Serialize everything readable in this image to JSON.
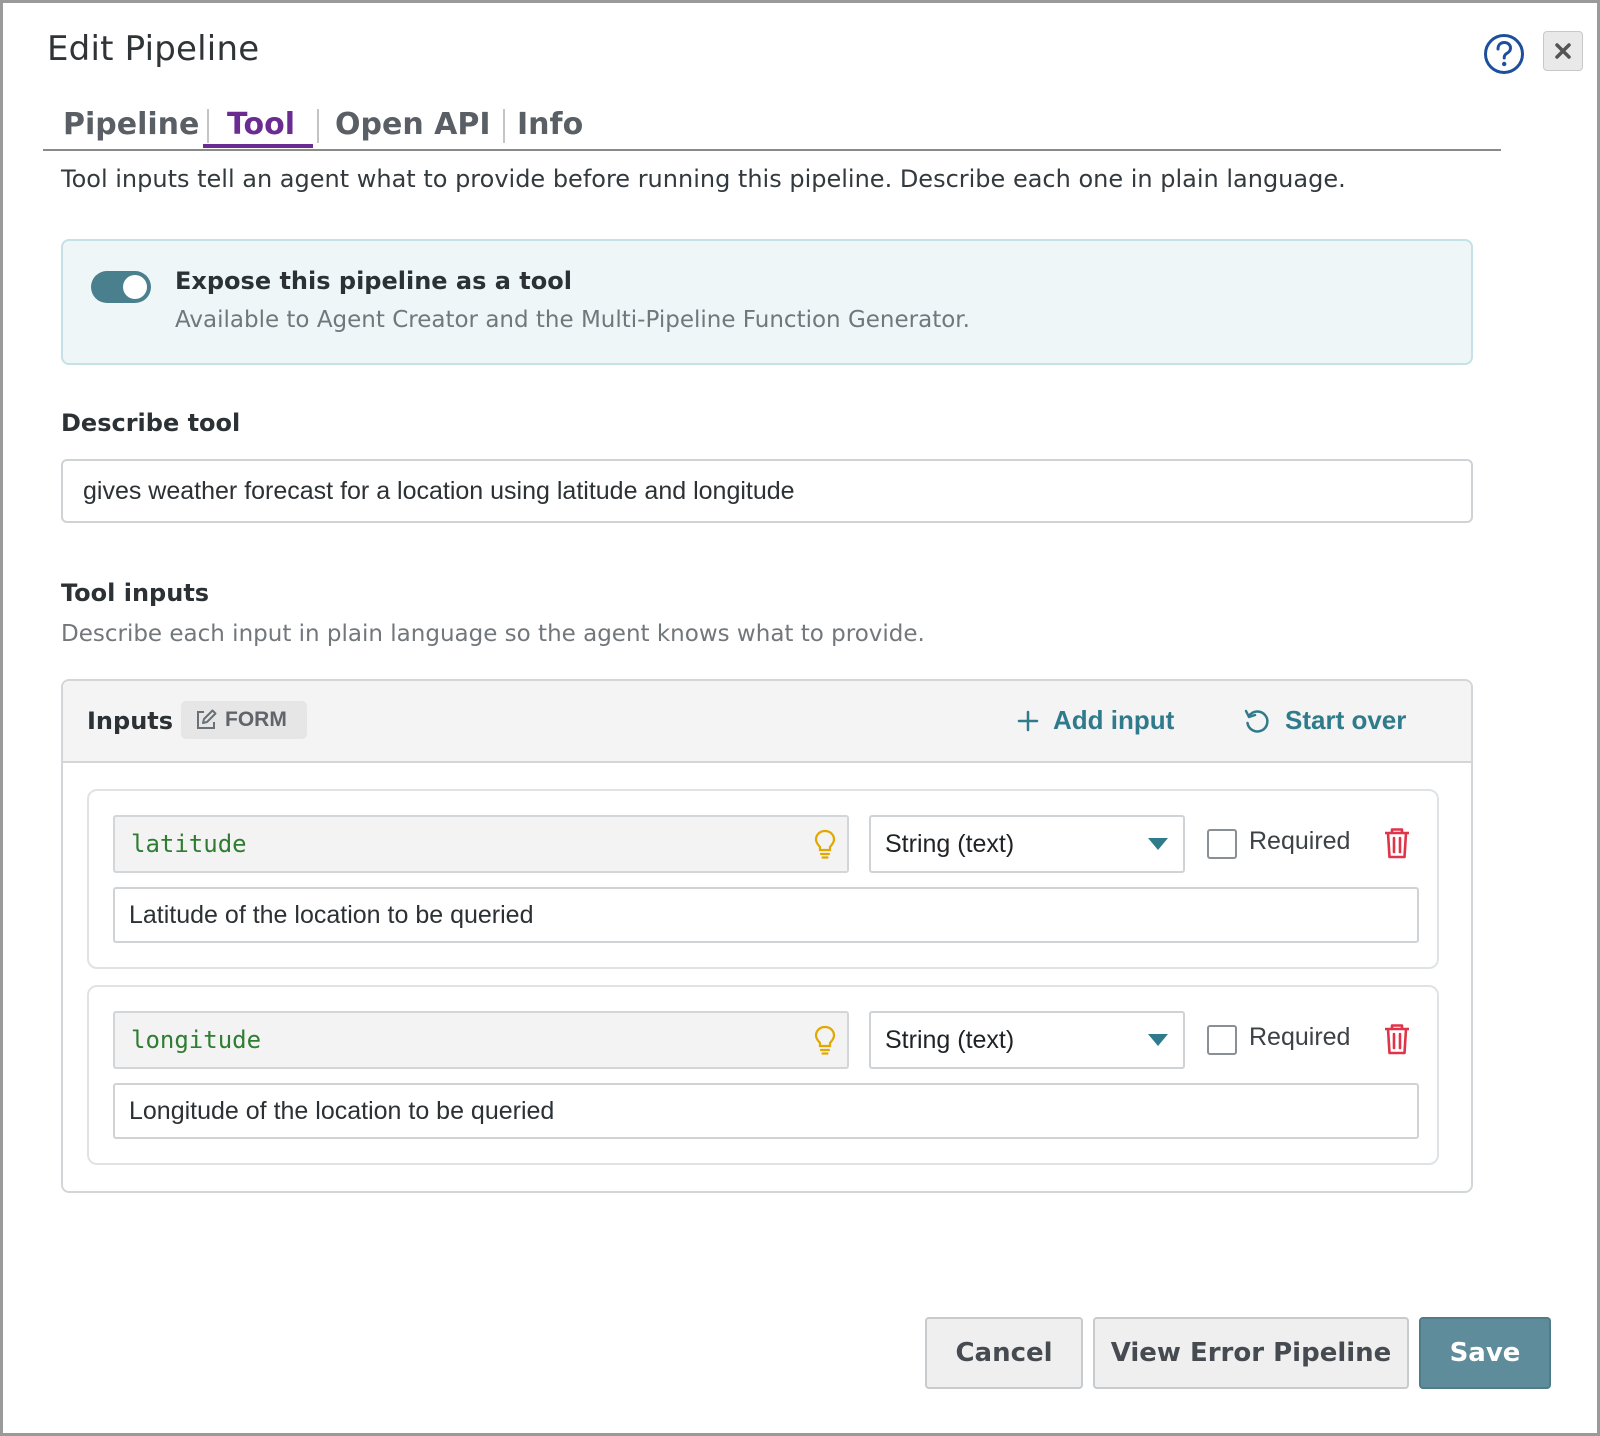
{
  "dialog": {
    "title": "Edit Pipeline"
  },
  "tabs": [
    {
      "label": "Pipeline",
      "active": false
    },
    {
      "label": "Tool",
      "active": true
    },
    {
      "label": "Open API",
      "active": false
    },
    {
      "label": "Info",
      "active": false
    }
  ],
  "intro_text": "Tool inputs tell an agent what to provide before running this pipeline. Describe each one in plain language.",
  "expose": {
    "enabled": true,
    "title": "Expose this pipeline as a tool",
    "subtitle": "Available to Agent Creator and the Multi-Pipeline Function Generator."
  },
  "describe_tool": {
    "label": "Describe tool",
    "value": "gives weather forecast for a location using latitude and longitude"
  },
  "tool_inputs": {
    "label": "Tool inputs",
    "hint": "Describe each input in plain language so the agent knows what to provide.",
    "panel_title": "Inputs",
    "badge": "FORM",
    "add_label": "Add input",
    "start_over_label": "Start over",
    "items": [
      {
        "name": "latitude",
        "type": "String (text)",
        "required_label": "Required",
        "required": false,
        "description": "Latitude of the location to be queried"
      },
      {
        "name": "longitude",
        "type": "String (text)",
        "required_label": "Required",
        "required": false,
        "description": "Longitude of the location to be queried"
      }
    ]
  },
  "footer": {
    "cancel_label": "Cancel",
    "view_error_label": "View Error Pipeline",
    "save_label": "Save"
  },
  "colors": {
    "accent_tab": "#6a2c91",
    "link": "#2f7b8c",
    "toggle_on": "#4a7f8e",
    "save_button": "#5e8c9a",
    "name_text": "#2e7d32",
    "delete": "#e0344a",
    "hint_icon": "#e0a800"
  }
}
